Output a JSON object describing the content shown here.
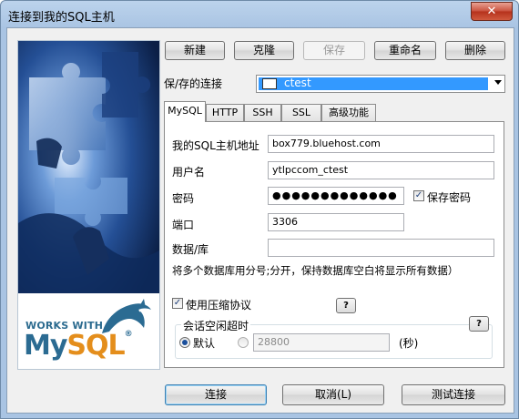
{
  "window": {
    "title": "连接到我的SQL主机",
    "close_glyph": "✕"
  },
  "brand": {
    "works_with": "WORKS WITH",
    "logo_my": "My",
    "logo_sql": "SQL",
    "logo_mark": "®"
  },
  "toolbar": {
    "new": "新建",
    "clone": "克隆",
    "save": "保存",
    "rename": "重命名",
    "delete": "删除"
  },
  "saved_connections": {
    "label": "保/存的连接",
    "selected": "ctest"
  },
  "tabs": [
    {
      "label": "MySQL",
      "active": true
    },
    {
      "label": "HTTP"
    },
    {
      "label": "SSH"
    },
    {
      "label": "SSL"
    },
    {
      "label": "高级功能"
    }
  ],
  "form": {
    "host_label": "我的SQL主机地址",
    "host_value": "box779.bluehost.com",
    "user_label": "用户名",
    "user_value": "ytlpccom_ctest",
    "password_label": "密码",
    "password_value": "●●●●●●●●●●●●●",
    "save_password_label": "保存密码",
    "port_label": "端口",
    "port_value": "3306",
    "database_label": "数据/库",
    "database_value": "",
    "database_hint": "将多个数据库用分号;分开，保持数据库空白将显示所有数据）",
    "compression_label": "使用压缩协议",
    "help_glyph": "?",
    "idle_timeout_label": "会话空闲超时",
    "default_label": "默认",
    "timeout_value": "28800",
    "seconds_label": "(秒)"
  },
  "footer": {
    "connect": "连接",
    "cancel": "取消(L)",
    "test": "测试连接"
  },
  "colors": {
    "selection": "#3399ff",
    "mysql_blue": "#2b6b92",
    "mysql_orange": "#e48e1c",
    "close_red": "#c9503c"
  }
}
